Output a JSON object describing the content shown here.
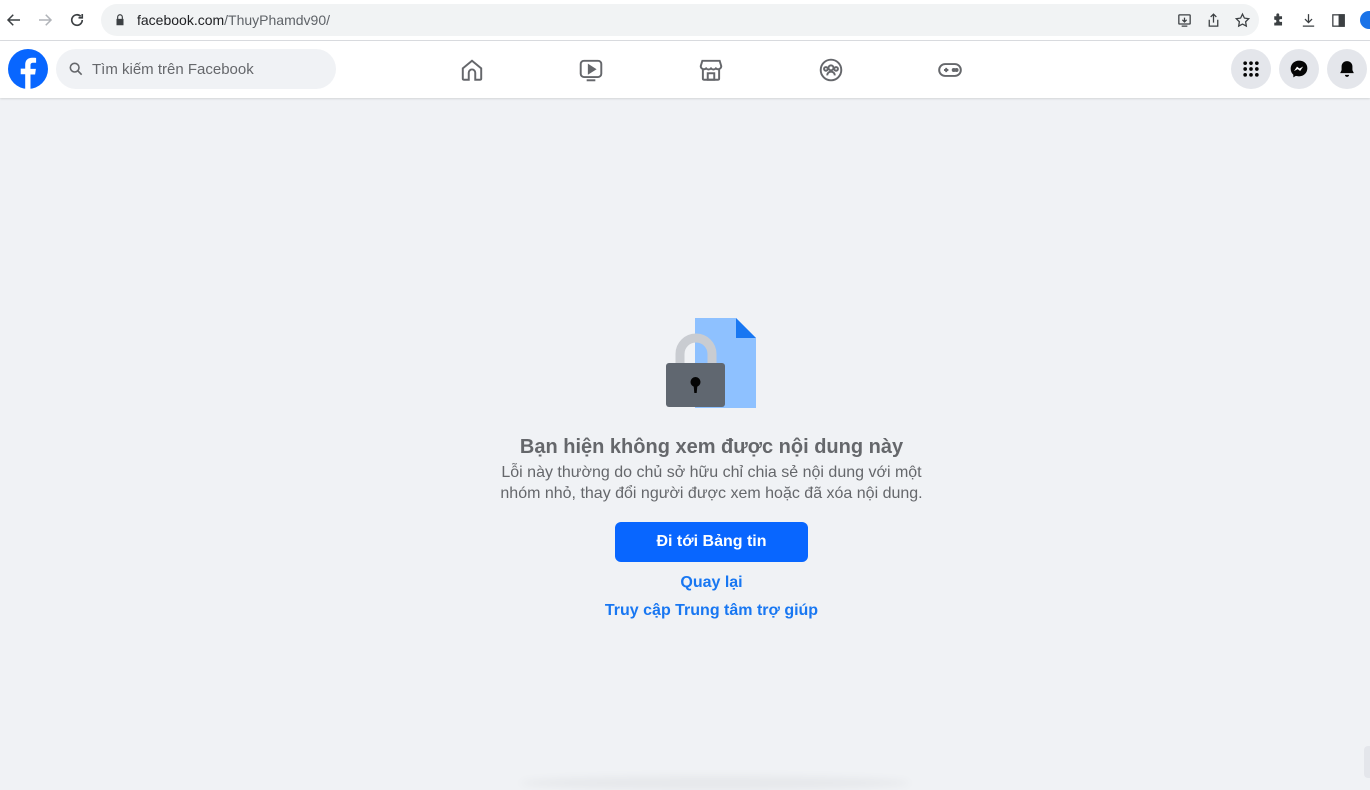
{
  "browser": {
    "url_host": "facebook.com",
    "url_path": "/ThuyPhamdv90/",
    "back_icon": "arrow-left-icon",
    "forward_icon": "arrow-right-icon",
    "reload_icon": "reload-icon",
    "lock_icon": "lock-icon"
  },
  "fb_header": {
    "search_placeholder": "Tìm kiếm trên Facebook",
    "brand_color": "#0866ff",
    "tabs": [
      "home-icon",
      "watch-icon",
      "marketplace-icon",
      "groups-icon",
      "gaming-icon"
    ],
    "right_buttons": [
      "menu-grid-icon",
      "messenger-icon",
      "notifications-icon"
    ]
  },
  "content": {
    "title": "Bạn hiện không xem được nội dung này",
    "description": "Lỗi này thường do chủ sở hữu chỉ chia sẻ nội dung với một nhóm nhỏ, thay đổi người được xem hoặc đã xóa nội dung.",
    "primary_button": "Đi tới Bảng tin",
    "back_link": "Quay lại",
    "help_link": "Truy cập Trung tâm trợ giúp",
    "link_color": "#1877f2",
    "text_color": "#65676b"
  }
}
